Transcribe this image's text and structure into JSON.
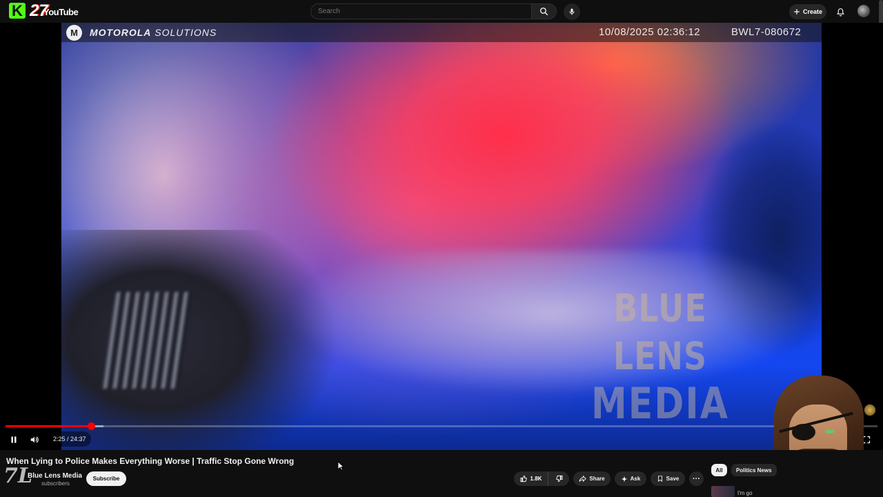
{
  "topbar": {
    "logo_k": "K",
    "logo_number": "27",
    "logo_text": "YouTube",
    "search_placeholder": "Search",
    "create_label": "Create",
    "icons": [
      "search-icon",
      "mic-icon",
      "plus-icon",
      "bell-icon",
      "avatar"
    ]
  },
  "video": {
    "bodycam_brand_bold": "MOTOROLA",
    "bodycam_brand_rest": "SOLUTIONS",
    "bodycam_timestamp": "10/08/2025 02:36:12",
    "bodycam_id": "BWL7-080672",
    "watermark_line1": "BLUE LENS",
    "watermark_line2": "MEDIA"
  },
  "controls": {
    "current_time": "2:25",
    "duration": "24:37",
    "time_display": "2:25 / 24:37",
    "progress_fraction": 0.098,
    "buffered_fraction": 0.112,
    "state": "playing",
    "accent_color": "#ff0000"
  },
  "info": {
    "title_visible": "When Lying to Police Makes Everything Worse | Traffic Stop Gone Wrong",
    "channel_name_visible": "Blue Lens Media",
    "subscribers_visible": "subscribers",
    "subscribe_label": "Subscribe",
    "like_count": "1.8K",
    "share_label": "Share",
    "ask_label": "Ask",
    "save_label": "Save",
    "more_label": "···",
    "chips": [
      "All",
      "Politics News"
    ],
    "rec_snippet": "I'm go"
  }
}
